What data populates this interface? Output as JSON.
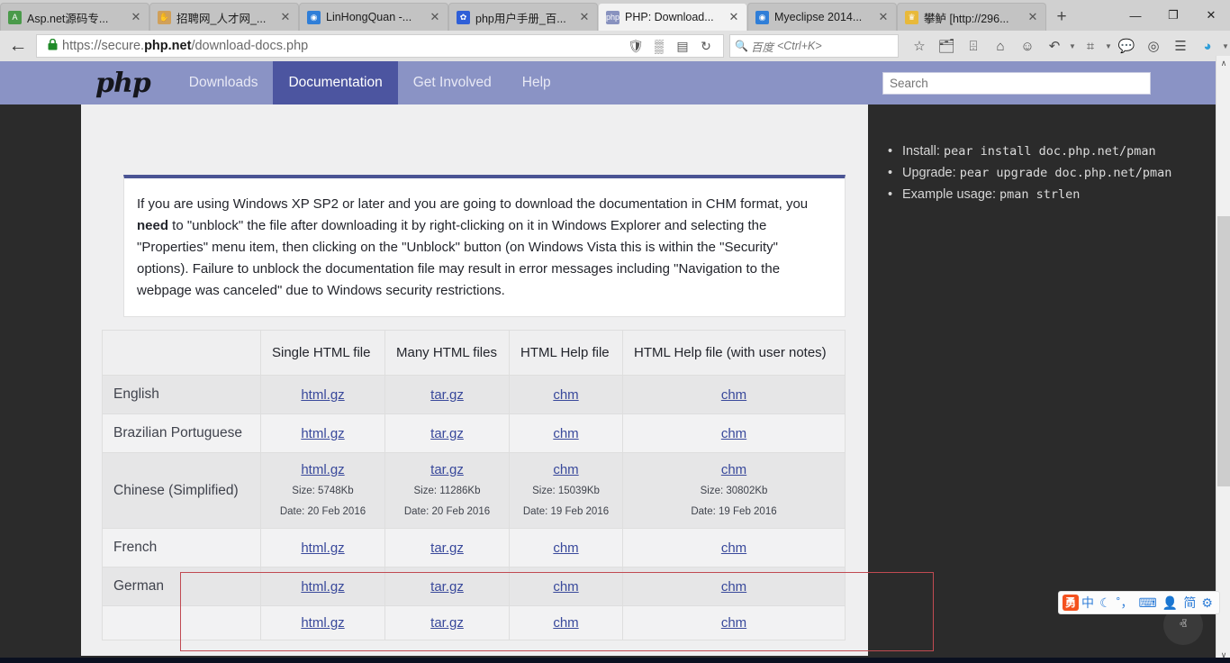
{
  "browser": {
    "tabs": [
      {
        "title": "Asp.net源码专...",
        "favicon": "asp-icon",
        "favicon_color": "#4a9a4a",
        "favicon_char": "A",
        "active": false
      },
      {
        "title": "招聘网_人才网_...",
        "favicon": "hand-icon",
        "favicon_color": "#d0a05a",
        "favicon_char": "✋",
        "active": false
      },
      {
        "title": "LinHongQuan -...",
        "favicon": "blue-circle-icon",
        "favicon_color": "#2f7ed8",
        "favicon_char": "◉",
        "active": false
      },
      {
        "title": "php用户手册_百...",
        "favicon": "baidu-icon",
        "favicon_color": "#2f5fd8",
        "favicon_char": "✿",
        "active": false
      },
      {
        "title": "PHP: Download...",
        "favicon": "php-icon",
        "favicon_color": "#8892bf",
        "favicon_char": "php",
        "active": true
      },
      {
        "title": "Myeclipse 2014...",
        "favicon": "myeclipse-icon",
        "favicon_color": "#2f7ed8",
        "favicon_char": "◉",
        "active": false
      },
      {
        "title": "攀鲈 [http://296...",
        "favicon": "yellow-icon",
        "favicon_color": "#e8b93a",
        "favicon_char": "♛",
        "active": false
      }
    ],
    "tab_close_glyph": "✕",
    "new_tab_label": "+",
    "window_controls": [
      "—",
      "❐",
      "✕"
    ],
    "back_glyph": "←",
    "lock_glyph": "🔒",
    "url_prefix": "https://secure.",
    "url_domain": "php.net",
    "url_path": "/download-docs.php",
    "url_icons": [
      "shield-icon",
      "qrcode-icon",
      "reader-icon",
      "reload-icon"
    ],
    "url_icon_glyphs": [
      "🛡",
      "▒",
      "▤",
      "↻"
    ],
    "search_engine_label": "百度",
    "search_shortcut": "<Ctrl+K>",
    "toolbar_icons": [
      "star-icon",
      "clipboard-icon",
      "counter-icon",
      "home-icon",
      "smiley-icon",
      "undo-icon",
      "crop-icon",
      "comment-icon",
      "globe-icon",
      "menu-icon",
      "droplet-icon"
    ],
    "toolbar_glyphs": [
      "☆",
      "🗂",
      "⌹",
      "⌂",
      "☺",
      "↶",
      "⌗",
      "💬",
      "◎",
      "☰",
      "◕"
    ]
  },
  "site_nav": {
    "logo": "php",
    "items": [
      {
        "label": "Downloads",
        "selected": false
      },
      {
        "label": "Documentation",
        "selected": true
      },
      {
        "label": "Get Involved",
        "selected": false
      },
      {
        "label": "Help",
        "selected": false
      }
    ],
    "search_placeholder": "Search"
  },
  "notice": {
    "part1": "If you are using Windows XP SP2 or later and you are going to download the documentation in CHM format, you ",
    "bold": "need",
    "part2": " to \"unblock\" the file after downloading it by right-clicking on it in Windows Explorer and selecting the \"Properties\" menu item, then clicking on the \"Unblock\" button (on Windows Vista this is within the \"Security\" options). Failure to unblock the documentation file may result in error messages including \"Navigation to the webpage was canceled\" due to Windows security restrictions."
  },
  "table": {
    "headers": [
      "",
      "Single HTML file",
      "Many HTML files",
      "HTML Help file",
      "HTML Help file (with user notes)"
    ],
    "link_labels": [
      "html.gz",
      "tar.gz",
      "chm",
      "chm"
    ],
    "rows": [
      {
        "language": "English",
        "highlight": false,
        "cells": [
          {
            "link": "html.gz"
          },
          {
            "link": "tar.gz"
          },
          {
            "link": "chm"
          },
          {
            "link": "chm"
          }
        ]
      },
      {
        "language": "Brazilian Portuguese",
        "highlight": false,
        "cells": [
          {
            "link": "html.gz"
          },
          {
            "link": "tar.gz"
          },
          {
            "link": "chm"
          },
          {
            "link": "chm"
          }
        ]
      },
      {
        "language": "Chinese (Simplified)",
        "highlight": true,
        "cells": [
          {
            "link": "html.gz",
            "size": "Size: 5748Kb",
            "date": "Date: 20 Feb 2016"
          },
          {
            "link": "tar.gz",
            "size": "Size: 11286Kb",
            "date": "Date: 20 Feb 2016"
          },
          {
            "link": "chm",
            "size": "Size: 15039Kb",
            "date": "Date: 19 Feb 2016"
          },
          {
            "link": "chm",
            "size": "Size: 30802Kb",
            "date": "Date: 19 Feb 2016"
          }
        ]
      },
      {
        "language": "French",
        "highlight": false,
        "cells": [
          {
            "link": "html.gz"
          },
          {
            "link": "tar.gz"
          },
          {
            "link": "chm"
          },
          {
            "link": "chm"
          }
        ]
      },
      {
        "language": "German",
        "highlight": false,
        "cells": [
          {
            "link": "html.gz"
          },
          {
            "link": "tar.gz"
          },
          {
            "link": "chm"
          },
          {
            "link": "chm"
          }
        ]
      },
      {
        "language": "",
        "highlight": false,
        "cells": [
          {
            "link": "html.gz"
          },
          {
            "link": "tar.gz"
          },
          {
            "link": "chm"
          },
          {
            "link": "chm"
          }
        ]
      }
    ],
    "highlight_color": "#c04a52"
  },
  "sidebar": {
    "items": [
      {
        "label": "Install:",
        "code": "pear install doc.php.net/pman"
      },
      {
        "label": "Upgrade:",
        "code": "pear upgrade doc.php.net/pman"
      },
      {
        "label": "Example usage:",
        "code": "pman strlen"
      }
    ]
  },
  "ime": {
    "items": [
      {
        "name": "sogou-logo-icon",
        "glyph": "勇",
        "type": "logo"
      },
      {
        "name": "chinese-mode-icon",
        "glyph": "中",
        "type": "blue"
      },
      {
        "name": "moon-icon",
        "glyph": "☾",
        "type": "blue"
      },
      {
        "name": "punctuation-icon",
        "glyph": "˚，",
        "type": "blue"
      },
      {
        "name": "keyboard-icon",
        "glyph": "⌨",
        "type": "blue"
      },
      {
        "name": "user-icon",
        "glyph": "👤",
        "type": "dark"
      },
      {
        "name": "simplified-icon",
        "glyph": "简",
        "type": "blue"
      },
      {
        "name": "settings-gear-icon",
        "glyph": "⚙",
        "type": "blue"
      }
    ]
  },
  "misc": {
    "scroll_top_glyph": "ⱏ",
    "scroll_up_glyph": "∧",
    "scroll_down_glyph": "∨"
  }
}
